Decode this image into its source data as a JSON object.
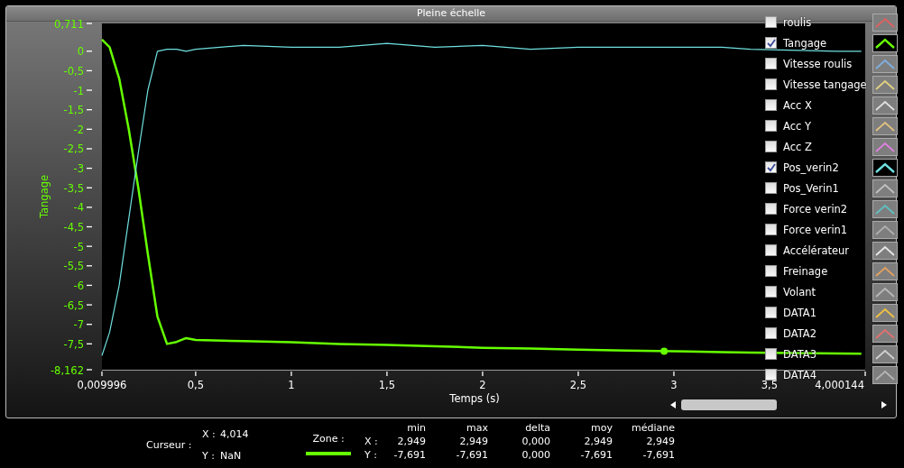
{
  "window": {
    "title": "Pleine échelle"
  },
  "chart": {
    "chart_data": {
      "type": "line",
      "xlabel": "Temps (s)",
      "ylabel": "Tangage",
      "x": [
        0.01,
        0.05,
        0.1,
        0.15,
        0.2,
        0.25,
        0.3,
        0.35,
        0.4,
        0.45,
        0.5,
        0.75,
        1,
        1.25,
        1.5,
        1.75,
        2,
        2.25,
        2.5,
        2.75,
        3,
        3.25,
        3.4,
        3.85,
        3.98
      ],
      "series": [
        {
          "color": "#66ff00",
          "values": [
            0.3,
            0.1,
            -0.7,
            -2.0,
            -3.5,
            -5.2,
            -6.8,
            -7.5,
            -7.45,
            -7.35,
            -7.4,
            -7.43,
            -7.46,
            -7.5,
            -7.53,
            -7.56,
            -7.6,
            -7.62,
            -7.65,
            -7.67,
            -7.69,
            -7.71,
            -7.72,
            -7.745,
            -7.75
          ]
        },
        {
          "color": "#70e0e0",
          "values": [
            -7.8,
            -7.2,
            -6.0,
            -4.3,
            -2.6,
            -1.0,
            0.0,
            0.05,
            0.05,
            0.0,
            0.05,
            0.15,
            0.1,
            0.1,
            0.2,
            0.1,
            0.15,
            0.05,
            0.1,
            0.1,
            0.1,
            0.1,
            0.05,
            0.0,
            0.0
          ]
        }
      ],
      "xlim": [
        0.009996,
        4.000144
      ],
      "ylim": [
        -8.162,
        0.711
      ],
      "xticks": [
        {
          "value": 0.009996,
          "label": "0,009996"
        },
        {
          "value": 0.5,
          "label": "0,5"
        },
        {
          "value": 1,
          "label": "1"
        },
        {
          "value": 1.5,
          "label": "1,5"
        },
        {
          "value": 2,
          "label": "2"
        },
        {
          "value": 2.5,
          "label": "2,5"
        },
        {
          "value": 3,
          "label": "3"
        },
        {
          "value": 3.5,
          "label": "3,5"
        },
        {
          "value": 4.000144,
          "label": "4,000144"
        }
      ],
      "yticks": [
        {
          "value": 0.711,
          "label": "0,711"
        },
        {
          "value": 0,
          "label": "0"
        },
        {
          "value": -0.5,
          "label": "-0,5"
        },
        {
          "value": -1,
          "label": "-1"
        },
        {
          "value": -1.5,
          "label": "-1,5"
        },
        {
          "value": -2,
          "label": "-2"
        },
        {
          "value": -2.5,
          "label": "-2,5"
        },
        {
          "value": -3,
          "label": "-3"
        },
        {
          "value": -3.5,
          "label": "-3,5"
        },
        {
          "value": -4,
          "label": "-4"
        },
        {
          "value": -4.5,
          "label": "-4,5"
        },
        {
          "value": -5,
          "label": "-5"
        },
        {
          "value": -5.5,
          "label": "-5,5"
        },
        {
          "value": -6,
          "label": "-6"
        },
        {
          "value": -6.5,
          "label": "-6,5"
        },
        {
          "value": -7,
          "label": "-7"
        },
        {
          "value": -7.5,
          "label": "-7,5"
        },
        {
          "value": -8.162,
          "label": "-8,162"
        }
      ]
    }
  },
  "legend": [
    {
      "label": "roulis",
      "checked": false,
      "color": "#e06060"
    },
    {
      "label": "Tangage",
      "checked": true,
      "color": "#66ff00"
    },
    {
      "label": "Vitesse roulis",
      "checked": false,
      "color": "#80b0e0"
    },
    {
      "label": "Vitesse tangage",
      "checked": false,
      "color": "#e0d080"
    },
    {
      "label": "Acc X",
      "checked": false,
      "color": "#e0e0e0"
    },
    {
      "label": "Acc Y",
      "checked": false,
      "color": "#e0c080"
    },
    {
      "label": "Acc Z",
      "checked": false,
      "color": "#e080e0"
    },
    {
      "label": "Pos_verin2",
      "checked": true,
      "color": "#70e0e0"
    },
    {
      "label": "Pos_Verin1",
      "checked": false,
      "color": "#c0c0c0"
    },
    {
      "label": "Force verin2",
      "checked": false,
      "color": "#60c0c0"
    },
    {
      "label": "Force verin1",
      "checked": false,
      "color": "#b0b0b0"
    },
    {
      "label": "Accélérateur",
      "checked": false,
      "color": "#e8e8e8"
    },
    {
      "label": "Freinage",
      "checked": false,
      "color": "#e0a060"
    },
    {
      "label": "Volant",
      "checked": false,
      "color": "#b8b8b8"
    },
    {
      "label": "DATA1",
      "checked": false,
      "color": "#f0c040"
    },
    {
      "label": "DATA2",
      "checked": false,
      "color": "#e07070"
    },
    {
      "label": "DATA3",
      "checked": false,
      "color": "#d0d0d0"
    },
    {
      "label": "DATA4",
      "checked": false,
      "color": "#b4b4b4"
    }
  ],
  "cursor": {
    "label": "Curseur :",
    "x_label": "X :",
    "x_value": "4,014",
    "y_label": "Y :",
    "y_value": "NaN"
  },
  "zone": {
    "label": "Zone :"
  },
  "stats": {
    "columns": [
      "min",
      "max",
      "delta",
      "moy",
      "médiane"
    ],
    "rows": [
      {
        "label": "X :",
        "values": [
          "2,949",
          "2,949",
          "0,000",
          "2,949",
          "2,949"
        ]
      },
      {
        "label": "Y :",
        "values": [
          "-7,691",
          "-7,691",
          "0,000",
          "-7,691",
          "-7,691"
        ]
      }
    ]
  }
}
